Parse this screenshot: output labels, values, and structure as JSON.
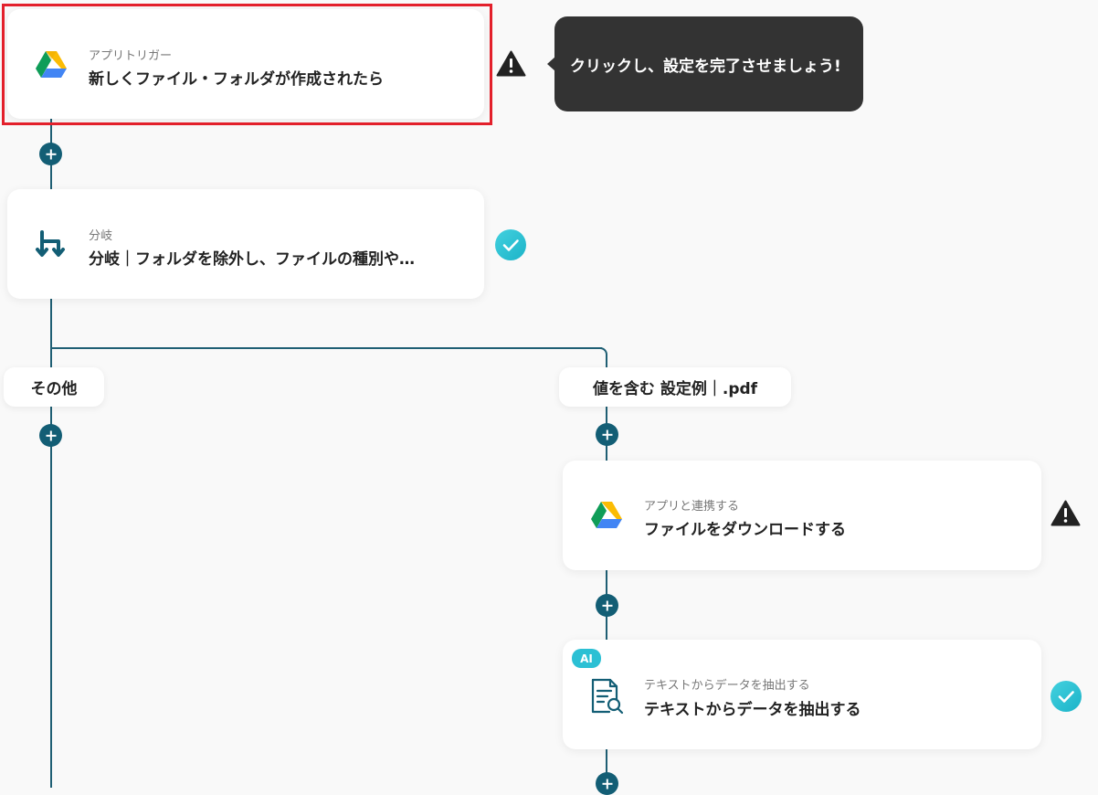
{
  "nodes": {
    "trigger": {
      "sub": "アプリトリガー",
      "title": "新しくファイル・フォルダが作成されたら",
      "status": "warning",
      "icon": "google-drive-icon"
    },
    "branch": {
      "sub": "分岐",
      "title": "分岐｜フォルダを除外し、ファイルの種別や…",
      "status": "complete",
      "icon": "branch-icon"
    },
    "download": {
      "sub": "アプリと連携する",
      "title": "ファイルをダウンロードする",
      "status": "warning",
      "icon": "google-drive-icon"
    },
    "extract": {
      "badge": "AI",
      "sub": "テキストからデータを抽出する",
      "title": "テキストからデータを抽出する",
      "status": "complete",
      "icon": "document-search-icon"
    }
  },
  "branches": {
    "left_label": "その他",
    "right_label": "値を含む 設定例｜.pdf"
  },
  "tooltip": {
    "text": "クリックし、設定を完了させましょう!"
  },
  "colors": {
    "line": "#1f5f74",
    "plus": "#135e75",
    "check": "#2bc0d4",
    "highlight": "#e3202b",
    "tooltip_bg": "#333333"
  }
}
